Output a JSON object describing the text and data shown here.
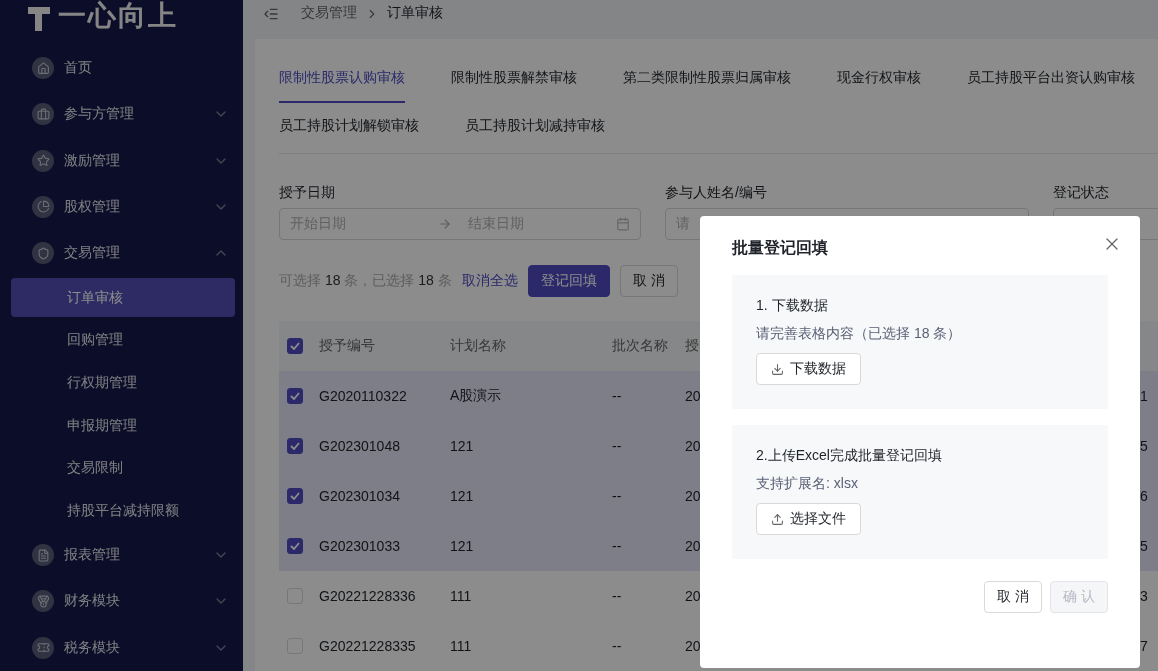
{
  "sidebar": {
    "logo": "一心向上",
    "items": [
      {
        "label": "首页"
      },
      {
        "label": "参与方管理",
        "expanded": false
      },
      {
        "label": "激励管理",
        "expanded": false
      },
      {
        "label": "股权管理",
        "expanded": false
      },
      {
        "label": "交易管理",
        "expanded": true,
        "children": [
          {
            "label": "订单审核",
            "selected": true
          },
          {
            "label": "回购管理",
            "selected": false
          },
          {
            "label": "行权期管理",
            "selected": false
          },
          {
            "label": "申报期管理",
            "selected": false
          },
          {
            "label": "交易限制",
            "selected": false
          },
          {
            "label": "持股平台减持限额",
            "selected": false
          }
        ]
      },
      {
        "label": "报表管理",
        "expanded": false
      },
      {
        "label": "财务模块",
        "expanded": false
      },
      {
        "label": "税务模块",
        "expanded": false
      }
    ]
  },
  "breadcrumb": [
    "交易管理",
    "订单审核"
  ],
  "tabs": [
    {
      "label": "限制性股票认购审核",
      "selected": true
    },
    {
      "label": "限制性股票解禁审核",
      "selected": false
    },
    {
      "label": "第二类限制性股票归属审核",
      "selected": false
    },
    {
      "label": "现金行权审核",
      "selected": false
    },
    {
      "label": "员工持股平台出资认购审核",
      "selected": false
    },
    {
      "label": "员工持股计划解锁审核",
      "selected": false
    },
    {
      "label": "员工持股计划减持审核",
      "selected": false
    }
  ],
  "filters": {
    "grant_date": {
      "label": "授予日期",
      "start_placeholder": "开始日期",
      "end_placeholder": "结束日期"
    },
    "participant": {
      "label": "参与人姓名/编号",
      "placeholder": "请"
    },
    "status": {
      "label": "登记状态"
    }
  },
  "selection": {
    "summary": "可选择 **18** 条，已选择 **18** 条",
    "clear_link": "取消全选",
    "primary_button": "登记回填",
    "cancel_button": "取 消"
  },
  "table": {
    "all_checked": true,
    "columns": [
      "授予编号",
      "计划名称",
      "批次名称",
      "授"
    ],
    "rows": [
      {
        "checked": true,
        "cells": [
          "G2020110322",
          "A股演示",
          "--",
          "20"
        ],
        "column_6": "1"
      },
      {
        "checked": true,
        "cells": [
          "G202301048",
          "121",
          "--",
          "20"
        ],
        "column_6": "5"
      },
      {
        "checked": true,
        "cells": [
          "G202301034",
          "121",
          "--",
          "20"
        ],
        "column_6": "6"
      },
      {
        "checked": true,
        "cells": [
          "G202301033",
          "121",
          "--",
          "20"
        ],
        "column_6": "5"
      },
      {
        "checked": false,
        "cells": [
          "G20221228336",
          "111",
          "--",
          "20"
        ],
        "column_6": "3"
      },
      {
        "checked": false,
        "cells": [
          "G20221228335",
          "111",
          "--",
          "20"
        ],
        "column_6": "7"
      }
    ]
  },
  "modal": {
    "title": "批量登记回填",
    "sections": [
      {
        "heading": "1. 下载数据",
        "hint": "请完善表格内容（已选择 18 条）",
        "button": "下载数据",
        "kind": "download"
      },
      {
        "heading": "2.上传Excel完成批量登记回填",
        "hint": "支持扩展名: xlsx",
        "button": "选择文件",
        "kind": "upload"
      }
    ],
    "cancel": {
      "label": "取 消",
      "disabled": false
    },
    "confirm": {
      "label": "确 认",
      "disabled": true
    }
  }
}
